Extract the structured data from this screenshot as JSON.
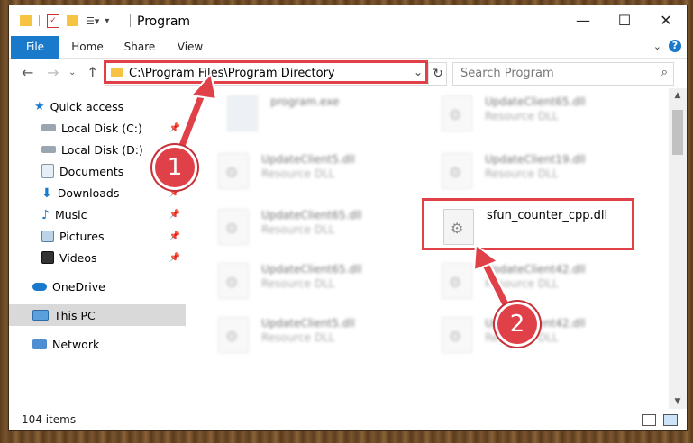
{
  "window": {
    "title": "Program",
    "controls": {
      "minimize": "—",
      "maximize": "☐",
      "close": "✕"
    }
  },
  "ribbon": {
    "tabs": [
      "File",
      "Home",
      "Share",
      "View"
    ]
  },
  "address": {
    "path": "C:\\Program Files\\Program Directory",
    "search_placeholder": "Search Program"
  },
  "nav": {
    "items": [
      {
        "label": "Quick access",
        "icon": "star-icon",
        "pinned": false
      },
      {
        "label": "Local Disk (C:)",
        "icon": "drive-icon",
        "pinned": true
      },
      {
        "label": "Local Disk (D:)",
        "icon": "drive-icon",
        "pinned": false
      },
      {
        "label": "Documents",
        "icon": "documents-icon",
        "pinned": true
      },
      {
        "label": "Downloads",
        "icon": "downloads-icon",
        "pinned": true
      },
      {
        "label": "Music",
        "icon": "music-icon",
        "pinned": true
      },
      {
        "label": "Pictures",
        "icon": "pictures-icon",
        "pinned": true
      },
      {
        "label": "Videos",
        "icon": "videos-icon",
        "pinned": true
      },
      {
        "label": "OneDrive",
        "icon": "cloud-icon",
        "pinned": false
      },
      {
        "label": "This PC",
        "icon": "computer-icon",
        "pinned": false,
        "selected": true
      },
      {
        "label": "Network",
        "icon": "network-icon",
        "pinned": false
      }
    ]
  },
  "files": [
    {
      "name": "program.exe",
      "type": ""
    },
    {
      "name": "UpdateClient65.dll",
      "type": "Resource DLL"
    },
    {
      "name": "UpdateClient5.dll",
      "type": "Resource DLL"
    },
    {
      "name": "UpdateClient19.dll",
      "type": "Resource DLL"
    },
    {
      "name": "UpdateClient65.dll",
      "type": "Resource DLL"
    },
    {
      "name": "sfun_counter_cpp.dll",
      "type": ""
    },
    {
      "name": "UpdateClient65.dll",
      "type": "Resource DLL"
    },
    {
      "name": "UpdateClient42.dll",
      "type": "Resource DLL"
    },
    {
      "name": "UpdateClient5.dll",
      "type": "Resource DLL"
    },
    {
      "name": "UpdateClient42.dll",
      "type": "Resource DLL"
    }
  ],
  "status": {
    "items": "104 items"
  },
  "callouts": [
    "1",
    "2"
  ],
  "colors": {
    "accent": "#1979ca",
    "highlight": "#e04048"
  }
}
